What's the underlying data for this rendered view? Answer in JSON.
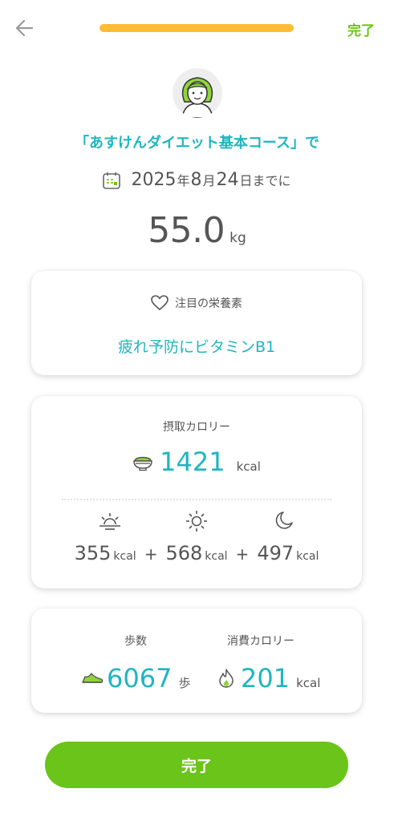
{
  "header": {
    "done_label": "完了",
    "progress_color": "#ffbd36"
  },
  "course": {
    "title": "「あすけんダイエット基本コース」で"
  },
  "goal": {
    "year": "2025",
    "year_unit": "年",
    "month": "8",
    "month_unit": "月",
    "day": "24",
    "day_suffix": "日までに",
    "weight": "55.0",
    "weight_unit": "kg"
  },
  "nutrient": {
    "heading": "注目の栄養素",
    "value": "疲れ予防にビタミンB1"
  },
  "intake": {
    "title": "摂取カロリー",
    "total": "1421",
    "unit": "kcal",
    "meals": [
      {
        "icon": "sunrise-icon",
        "value": "355",
        "unit": "kcal"
      },
      {
        "icon": "sun-icon",
        "value": "568",
        "unit": "kcal"
      },
      {
        "icon": "moon-icon",
        "value": "497",
        "unit": "kcal"
      }
    ],
    "plus": "+"
  },
  "activity": {
    "steps_title": "歩数",
    "steps_value": "6067",
    "steps_unit": "歩",
    "burn_title": "消費カロリー",
    "burn_value": "201",
    "burn_unit": "kcal"
  },
  "footer": {
    "done_label": "完了"
  },
  "colors": {
    "accent_teal": "#1fb6bf",
    "accent_green": "#6ac41a",
    "progress_yellow": "#ffbd36"
  }
}
